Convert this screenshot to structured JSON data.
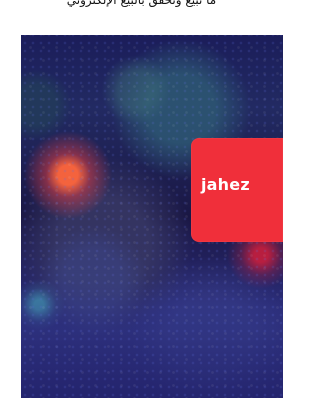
{
  "top_text": "ما تبيع وتحقق بالبيع الإلكتروني",
  "brand": {
    "logo_text": "jahez",
    "accent": "#f02f3a"
  },
  "hero": {
    "background_color": "#1f1f5a",
    "highlight_colors": [
      "#ff6a3c",
      "#46b4be",
      "#eb1e37"
    ]
  }
}
